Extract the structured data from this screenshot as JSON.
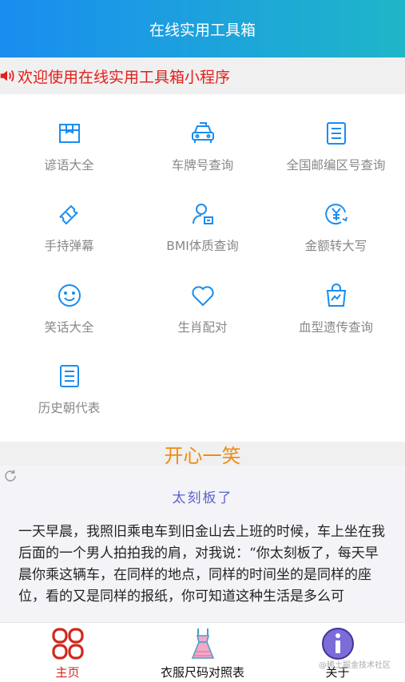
{
  "header": {
    "title": "在线实用工具箱"
  },
  "notice": {
    "text": "欢迎使用在线实用工具箱小程序"
  },
  "tools": [
    {
      "label": "谚语大全",
      "icon": "box-icon"
    },
    {
      "label": "车牌号查询",
      "icon": "car-icon"
    },
    {
      "label": "全国邮编区号查询",
      "icon": "document-icon"
    },
    {
      "label": "手持弹幕",
      "icon": "ticket-icon"
    },
    {
      "label": "BMI体质查询",
      "icon": "user-id-icon"
    },
    {
      "label": "金额转大写",
      "icon": "yen-icon"
    },
    {
      "label": "笑话大全",
      "icon": "smile-icon"
    },
    {
      "label": "生肖配对",
      "icon": "heart-icon"
    },
    {
      "label": "血型遗传查询",
      "icon": "bag-icon"
    },
    {
      "label": "历史朝代表",
      "icon": "document-icon"
    }
  ],
  "joke": {
    "section_title": "开心一笑",
    "heading": "太刻板了",
    "body": "一天早晨，我照旧乘电车到旧金山去上班的时候，车上坐在我后面的一个男人拍拍我的肩，对我说：“你太刻板了，每天早晨你乘这辆车，在同样的地点，同样的时间坐的是同样的座位，看的又是同样的报纸，你可知道这种生活是多么可"
  },
  "tabbar": {
    "items": [
      {
        "label": "主页",
        "icon": "home-grid-icon",
        "active": true
      },
      {
        "label": "衣服尺码对照表",
        "icon": "dress-icon",
        "active": false
      },
      {
        "label": "关于",
        "icon": "info-icon",
        "active": false
      }
    ]
  },
  "watermark": "@稀土掘金技术社区",
  "colors": {
    "accent": "#1a8df0",
    "notice_red": "#e0201c",
    "joke_orange": "#f08a15",
    "active_tab": "#d0281e"
  }
}
